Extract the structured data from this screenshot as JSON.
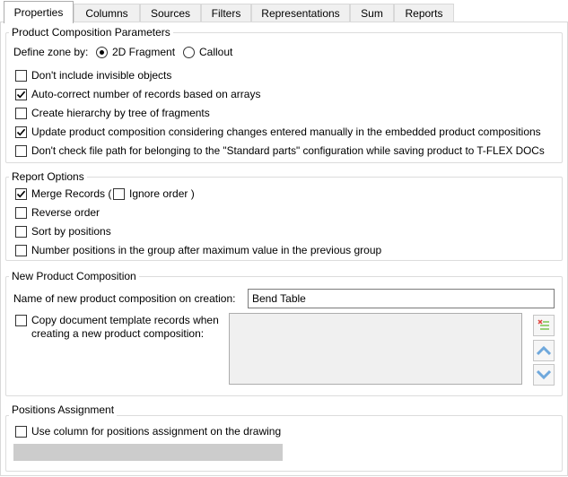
{
  "tabs": [
    {
      "label": "Properties"
    },
    {
      "label": "Columns"
    },
    {
      "label": "Sources"
    },
    {
      "label": "Filters"
    },
    {
      "label": "Representations"
    },
    {
      "label": "Sum"
    },
    {
      "label": "Reports"
    }
  ],
  "product_composition": {
    "title": "Product Composition Parameters",
    "define_zone_label": "Define zone by:",
    "zone_options": [
      "2D Fragment",
      "Callout"
    ],
    "selected_zone": "2D Fragment",
    "options": [
      {
        "label": "Don't include invisible objects",
        "checked": false
      },
      {
        "label": "Auto-correct number of records based on arrays",
        "checked": true
      },
      {
        "label": "Create hierarchy by tree of fragments",
        "checked": false
      },
      {
        "label": "Update product composition considering changes entered manually in the embedded product compositions",
        "checked": true
      },
      {
        "label": "Don't check file path for belonging to the \"Standard parts\" configuration while saving product to T-FLEX DOCs",
        "checked": false
      }
    ]
  },
  "report_options": {
    "title": "Report Options",
    "merge_records": {
      "label": "Merge Records (",
      "checked": true
    },
    "ignore_order": {
      "label": "Ignore order )",
      "checked": false
    },
    "options": [
      {
        "label": "Reverse order",
        "checked": false
      },
      {
        "label": "Sort by positions",
        "checked": false
      },
      {
        "label": "Number positions in the group after maximum value in the previous group",
        "checked": false
      }
    ]
  },
  "new_product_composition": {
    "title": "New Product Composition",
    "name_label": "Name of new product composition on creation:",
    "name_value": "Bend Table",
    "copy_template": {
      "label_line1": "Copy document template records when",
      "label_line2": "creating a new product composition:",
      "checked": false
    },
    "buttons": [
      "delete-list-icon",
      "arrow-up-icon",
      "arrow-down-icon"
    ]
  },
  "positions_assignment": {
    "title": "Positions Assignment",
    "use_column": {
      "label": "Use column for positions assignment on the drawing",
      "checked": false
    }
  },
  "colors": {
    "check": "#000000",
    "accent_red": "#e0403a",
    "arrow_blue": "#6fa8dc"
  }
}
